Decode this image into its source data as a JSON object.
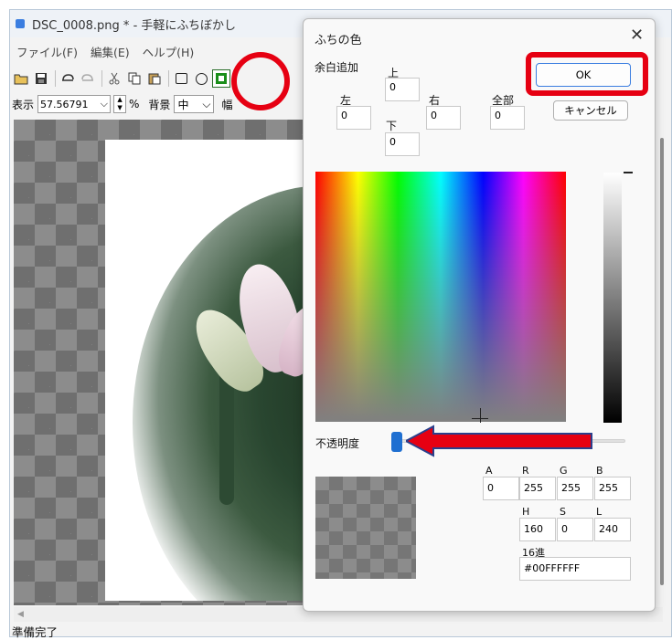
{
  "window": {
    "title": "DSC_0008.png * - 手軽にふちぼかし"
  },
  "menu": {
    "items": [
      "ファイル(F)",
      "編集(E)",
      "ヘルプ(H)"
    ]
  },
  "viewbar": {
    "display_label": "表示",
    "zoom_value": "57.56791",
    "percent_label": "%",
    "bg_label": "背景",
    "bg_value": "中",
    "extra_label": "幅"
  },
  "status": {
    "text": "準備完了"
  },
  "dialog": {
    "title": "ふちの色",
    "close_glyph": "✕",
    "margin_label": "余白追加",
    "top_label": "上",
    "top_value": "0",
    "left_label": "左",
    "left_value": "0",
    "right_label": "右",
    "right_value": "0",
    "bottom_label": "下",
    "bottom_value": "0",
    "all_label": "全部",
    "all_value": "0",
    "ok_label": "OK",
    "cancel_label": "キャンセル",
    "opacity_label": "不透明度",
    "opacity_value": 0,
    "a_label": "A",
    "a_value": "0",
    "r_label": "R",
    "r_value": "255",
    "g_label": "G",
    "g_value": "255",
    "b_label": "B",
    "b_value": "255",
    "h_label": "H",
    "h_value": "160",
    "s_label": "S",
    "s_value": "0",
    "l_label": "L",
    "l_value": "240",
    "hex_label": "16進",
    "hex_value": "#00FFFFFF"
  },
  "colors": {
    "highlight": "#e60012",
    "accent": "#1f6fd1"
  }
}
